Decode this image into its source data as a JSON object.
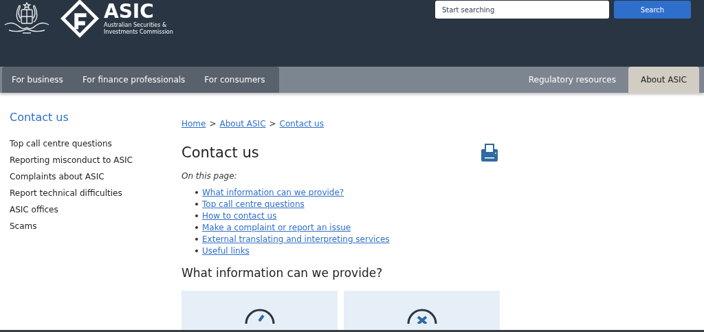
{
  "header": {
    "brand": "ASIC",
    "brand_subtitle_lines": [
      "Australian Securities &",
      "Investments Commission"
    ],
    "search": {
      "placeholder": "Start searching",
      "button": "Search"
    }
  },
  "nav": [
    {
      "label": "For business",
      "kind": "primary",
      "selected": false
    },
    {
      "label": "For finance professionals",
      "kind": "primary",
      "selected": false
    },
    {
      "label": "For consumers",
      "kind": "primary",
      "selected": false
    },
    {
      "label": "Regulatory resources",
      "kind": "secondary",
      "selected": false
    },
    {
      "label": "About ASIC",
      "kind": "secondary",
      "selected": true
    }
  ],
  "sidebar": {
    "title": "Contact us",
    "items": [
      "Top call centre questions",
      "Reporting misconduct to ASIC",
      "Complaints about ASIC",
      "Report technical difficulties",
      "ASIC offices",
      "Scams"
    ]
  },
  "breadcrumb": [
    "Home",
    "About ASIC",
    "Contact us"
  ],
  "breadcrumb_separator": ">",
  "page_title": "Contact us",
  "on_this_page": "On this page:",
  "toc": [
    "What information can we provide?",
    "Top call centre questions",
    "How to contact us",
    "Make a complaint or report an issue",
    "External translating and interpreting services",
    "Useful links"
  ],
  "section_title": "What information can we provide?",
  "cards": [
    {
      "kind": "check"
    },
    {
      "kind": "cross"
    }
  ]
}
